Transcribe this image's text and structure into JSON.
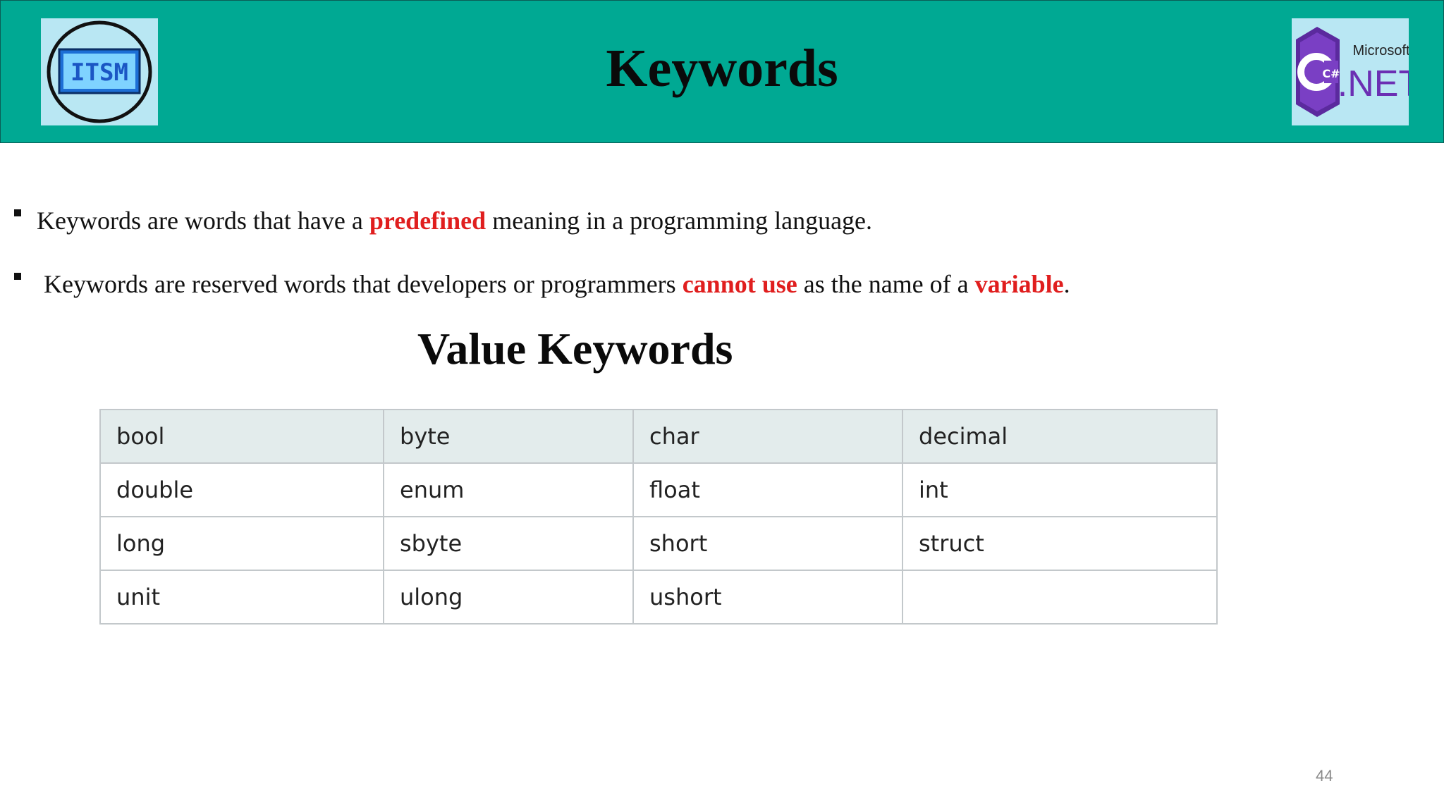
{
  "header": {
    "title": "Keywords",
    "left_logo": {
      "text": "ITSM",
      "icon": "itsm-logo"
    },
    "right_logo": {
      "brand_top": "Microsoft",
      "brand_main": ".NET",
      "badge_text": "C#",
      "icon": "csharp-dotnet-logo"
    },
    "background_color": "#00a993"
  },
  "bullets": [
    {
      "pre": "Keywords are words that have a ",
      "highlight": "predefined",
      "post": " meaning in a programming language."
    },
    {
      "pre": "Keywords are reserved words that developers or programmers ",
      "highlight1": "cannot use",
      "mid": " as the name of a ",
      "highlight2": "variable",
      "post": "."
    }
  ],
  "highlight_color": "#e01e1e",
  "section_title": "Value Keywords",
  "table": {
    "rows": [
      [
        "bool",
        "byte",
        "char",
        "decimal"
      ],
      [
        "double",
        "enum",
        "float",
        "int"
      ],
      [
        "long",
        "sbyte",
        "short",
        "struct"
      ],
      [
        "unit",
        "ulong",
        "ushort",
        ""
      ]
    ]
  },
  "page_number": "44"
}
